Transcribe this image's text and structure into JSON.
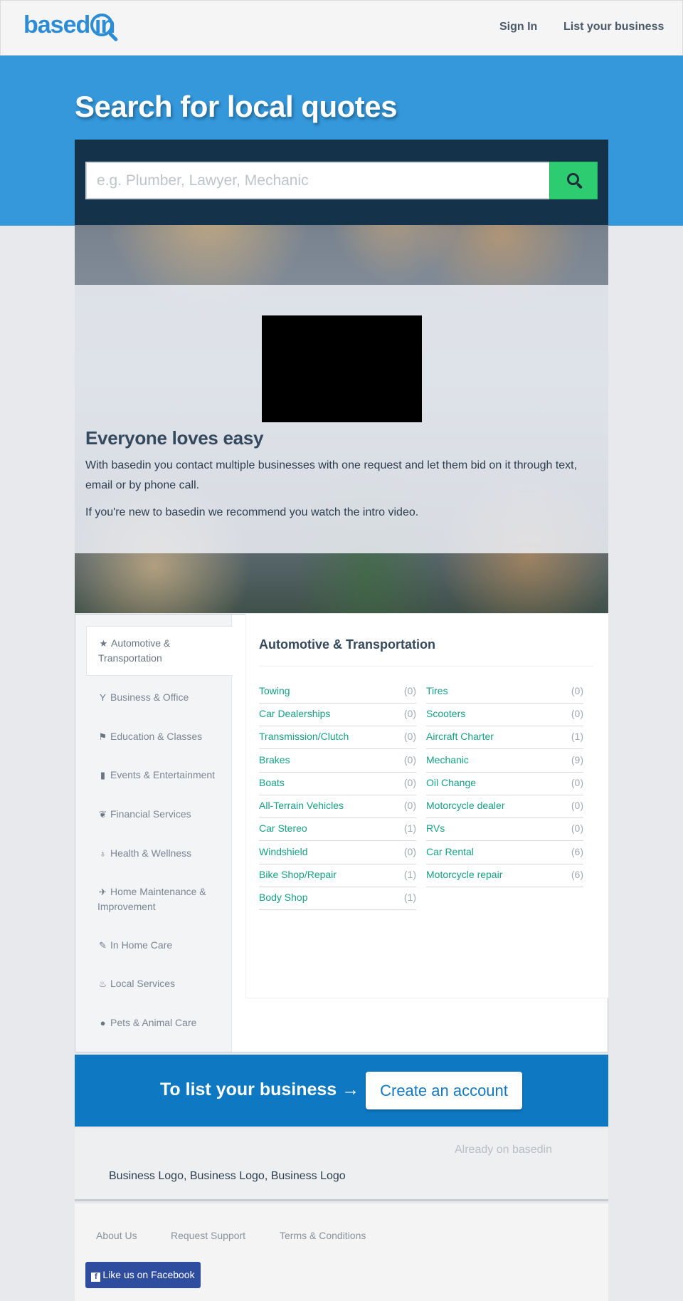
{
  "header": {
    "logo_text": "basedin",
    "sign_in": "Sign In",
    "list_business": "List your business"
  },
  "hero": {
    "title": "Search for local quotes"
  },
  "search": {
    "placeholder": "e.g. Plumber, Lawyer, Mechanic",
    "value": ""
  },
  "intro": {
    "title": "Everyone loves easy",
    "paragraph_1": "With basedin you contact multiple businesses with one request and let them bid on it through text, email or by phone call.",
    "paragraph_2": "If you're new to basedin we recommend you watch the intro video."
  },
  "categories": {
    "items": [
      {
        "label": "Automotive & Transportation",
        "icon": "star-icon",
        "glyph": "★",
        "active": true
      },
      {
        "label": "Business & Office",
        "icon": "glass-icon",
        "glyph": "Y",
        "active": false
      },
      {
        "label": "Education & Classes",
        "icon": "flag-icon",
        "glyph": "⚑",
        "active": false
      },
      {
        "label": "Events & Entertainment",
        "icon": "book-icon",
        "glyph": "▮",
        "active": false
      },
      {
        "label": "Financial Services",
        "icon": "leaf-icon",
        "glyph": "❦",
        "active": false
      },
      {
        "label": "Health & Wellness",
        "icon": "stethoscope-icon",
        "glyph": "♁",
        "active": false
      },
      {
        "label": "Home Maintenance & Improvement",
        "icon": "plane-icon",
        "glyph": "✈",
        "active": false
      },
      {
        "label": "In Home Care",
        "icon": "wrench-icon",
        "glyph": "✎",
        "active": false
      },
      {
        "label": "Local Services",
        "icon": "fire-icon",
        "glyph": "♨",
        "active": false
      },
      {
        "label": "Pets & Animal Care",
        "icon": "user-icon",
        "glyph": "●",
        "active": false
      }
    ],
    "active_title": "Automotive & Transportation",
    "left_column": [
      {
        "label": "Towing",
        "count": "(0)"
      },
      {
        "label": "Car Dealerships",
        "count": "(0)"
      },
      {
        "label": "Transmission/Clutch",
        "count": "(0)"
      },
      {
        "label": "Brakes",
        "count": "(0)"
      },
      {
        "label": "Boats",
        "count": "(0)"
      },
      {
        "label": "All-Terrain Vehicles",
        "count": "(0)"
      },
      {
        "label": "Car Stereo",
        "count": "(1)"
      },
      {
        "label": "Windshield",
        "count": "(0)"
      },
      {
        "label": "Bike Shop/Repair",
        "count": "(1)"
      },
      {
        "label": "Body Shop",
        "count": "(1)"
      }
    ],
    "right_column": [
      {
        "label": "Tires",
        "count": "(0)"
      },
      {
        "label": "Scooters",
        "count": "(0)"
      },
      {
        "label": "Aircraft Charter",
        "count": "(1)"
      },
      {
        "label": "Mechanic",
        "count": "(9)"
      },
      {
        "label": "Oil Change",
        "count": "(0)"
      },
      {
        "label": "Motorcycle dealer",
        "count": "(0)"
      },
      {
        "label": "RVs",
        "count": "(0)"
      },
      {
        "label": "Car Rental",
        "count": "(6)"
      },
      {
        "label": "Motorcycle repair",
        "count": "(6)"
      }
    ]
  },
  "cta": {
    "text": "To list your business →",
    "button": "Create an account"
  },
  "already": {
    "label": "Already on basedin",
    "logos": "Business Logo, Business Logo, Business Logo"
  },
  "footer": {
    "about": "About Us",
    "support": "Request Support",
    "terms": "Terms & Conditions",
    "facebook": "Like us on Facebook"
  },
  "colors": {
    "brand_blue": "#3498db",
    "accent_green": "#2ecc71",
    "link_green": "#16a085",
    "cta_blue": "#0e79c2",
    "facebook_blue": "#2e4d9f"
  }
}
